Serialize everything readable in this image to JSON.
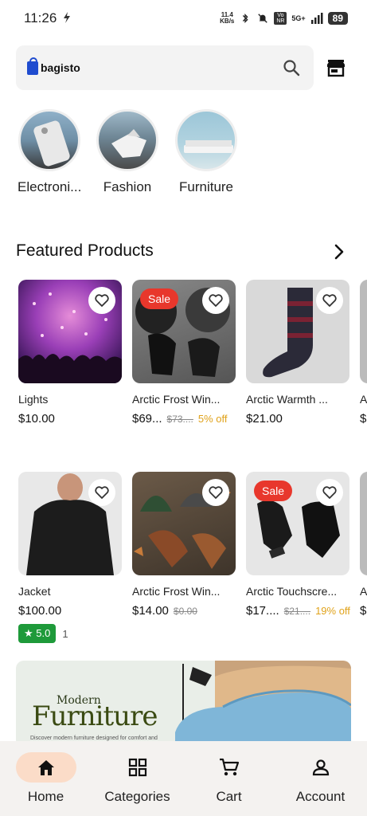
{
  "status": {
    "time": "11:26",
    "speed_value": "11.4",
    "speed_unit": "KB/s",
    "volte": "Vo NR",
    "network": "5G+",
    "battery": "89"
  },
  "search": {
    "logo_text": "bagisto",
    "icons": [
      "search-icon",
      "store-icon"
    ]
  },
  "categories": [
    {
      "label": "Electroni..."
    },
    {
      "label": "Fashion"
    },
    {
      "label": "Furniture"
    }
  ],
  "featured": {
    "title": "Featured Products"
  },
  "products_row1": [
    {
      "name": "Lights",
      "price": "$10.00"
    },
    {
      "name": "Arctic Frost Win...",
      "price": "$69...",
      "old_price": "$73....",
      "discount": "5% off",
      "sale": "Sale"
    },
    {
      "name": "Arctic Warmth ...",
      "price": "$21.00"
    },
    {
      "name": "A",
      "price": "$"
    }
  ],
  "products_row2": [
    {
      "name": "Jacket",
      "price": "$100.00",
      "rating": "5.0",
      "rating_count": "1"
    },
    {
      "name": "Arctic Frost Win...",
      "price": "$14.00",
      "old_price": "$0.00"
    },
    {
      "name": "Arctic Touchscre...",
      "price": "$17....",
      "old_price": "$21....",
      "discount": "19% off",
      "sale": "Sale"
    },
    {
      "name": "A",
      "price": "$"
    }
  ],
  "banner": {
    "line1": "Modern",
    "line2": "Furniture",
    "line3": "Discover modern furniture designed for comfort and"
  },
  "nav": [
    {
      "label": "Home",
      "icon": "home-icon",
      "active": true
    },
    {
      "label": "Categories",
      "icon": "grid-icon"
    },
    {
      "label": "Cart",
      "icon": "cart-icon"
    },
    {
      "label": "Account",
      "icon": "account-icon"
    }
  ],
  "colors": {
    "sale": "#e8372c",
    "discount": "#e0a21a",
    "rating": "#1e9a3a",
    "nav_active": "#fbdcc8",
    "logo": "#1f4ccf"
  }
}
